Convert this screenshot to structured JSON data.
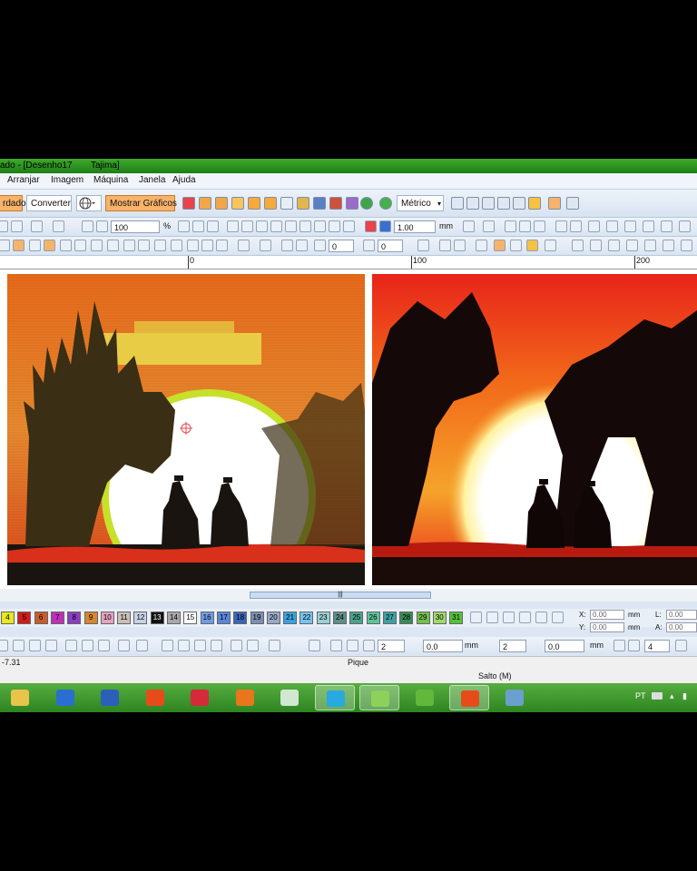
{
  "window": {
    "title_left": "ado - [Desenho17",
    "title_right": "Tajima]"
  },
  "menu": [
    {
      "label": "Arranjar"
    },
    {
      "label": "Imagem"
    },
    {
      "label": "Máquina"
    },
    {
      "label": "Janela"
    },
    {
      "label": "Ajuda"
    }
  ],
  "toolbar1": {
    "bordado_label": "rdado",
    "converter_label": "Converter",
    "mostrar_graficos_label": "Mostrar Gráficos",
    "units_select": "Métrico"
  },
  "toolbar2": {
    "zoom_value": "100",
    "zoom_unit": "%",
    "stitch_width_value": "1.00",
    "stitch_width_unit": "mm"
  },
  "toolbar3": {
    "rotate_value": "0",
    "slant_value": "0"
  },
  "ruler": {
    "labels": [
      "0",
      "100",
      "200"
    ]
  },
  "palette": {
    "colors": [
      {
        "num": "4",
        "color": "#e8e81a"
      },
      {
        "num": "5",
        "color": "#d01c1c"
      },
      {
        "num": "6",
        "color": "#c85c2a"
      },
      {
        "num": "7",
        "color": "#c02fb8"
      },
      {
        "num": "8",
        "color": "#8a3fbf"
      },
      {
        "num": "9",
        "color": "#d6862e"
      },
      {
        "num": "10",
        "color": "#e6a3bf"
      },
      {
        "num": "11",
        "color": "#c9bfb8"
      },
      {
        "num": "12",
        "color": "#c8d0e6"
      },
      {
        "num": "13",
        "color": "#111111"
      },
      {
        "num": "14",
        "color": "#a8a8a8"
      },
      {
        "num": "15",
        "color": "#ffffff"
      },
      {
        "num": "16",
        "color": "#6f9be6"
      },
      {
        "num": "17",
        "color": "#5a86d8"
      },
      {
        "num": "18",
        "color": "#3b63b8"
      },
      {
        "num": "19",
        "color": "#7c8fb3"
      },
      {
        "num": "20",
        "color": "#98a9c9"
      },
      {
        "num": "21",
        "color": "#3aa0e0"
      },
      {
        "num": "22",
        "color": "#73c4ef"
      },
      {
        "num": "23",
        "color": "#99d0d6"
      },
      {
        "num": "24",
        "color": "#5d8f8a"
      },
      {
        "num": "25",
        "color": "#4aa28c"
      },
      {
        "num": "26",
        "color": "#5fc39a"
      },
      {
        "num": "27",
        "color": "#3fa0a2"
      },
      {
        "num": "28",
        "color": "#3b8a56"
      },
      {
        "num": "29",
        "color": "#72c04c"
      },
      {
        "num": "30",
        "color": "#9fd86a"
      },
      {
        "num": "31",
        "color": "#52c23a"
      }
    ]
  },
  "coords": {
    "x_label": "X:",
    "x_value": "0.00",
    "x_unit": "mm",
    "y_label": "Y:",
    "y_value": "0.00",
    "y_unit": "mm",
    "l_label": "L:",
    "l_value": "0.00",
    "a_label": "A:",
    "a_value": "0.00"
  },
  "toolbar4": {
    "field1": "2",
    "field2": "0.0",
    "unit2": "mm",
    "field3": "2",
    "field4": "0.0",
    "unit4": "mm",
    "field5": "4"
  },
  "status": {
    "coord": "-7.31",
    "stitch_type": "Pique",
    "jump": "Salto (M)"
  },
  "taskbar": {
    "language": "PT",
    "apps": [
      {
        "name": "file-explorer",
        "color": "#e8c44a"
      },
      {
        "name": "teamviewer",
        "color": "#2a6fcf"
      },
      {
        "name": "word",
        "color": "#2b5fb8"
      },
      {
        "name": "wilcom-flame",
        "color": "#e84b1a"
      },
      {
        "name": "kaspersky",
        "color": "#d42a3a"
      },
      {
        "name": "firefox",
        "color": "#e8761a"
      },
      {
        "name": "app-window",
        "color": "#cfe8cf"
      },
      {
        "name": "skype",
        "color": "#2aa8e0"
      },
      {
        "name": "embroidery-app",
        "color": "#8fd05a"
      },
      {
        "name": "design-app",
        "color": "#62b83a"
      },
      {
        "name": "wilcom-flame-active",
        "color": "#e84b1a"
      },
      {
        "name": "screen-app",
        "color": "#6b9fd0"
      }
    ]
  }
}
